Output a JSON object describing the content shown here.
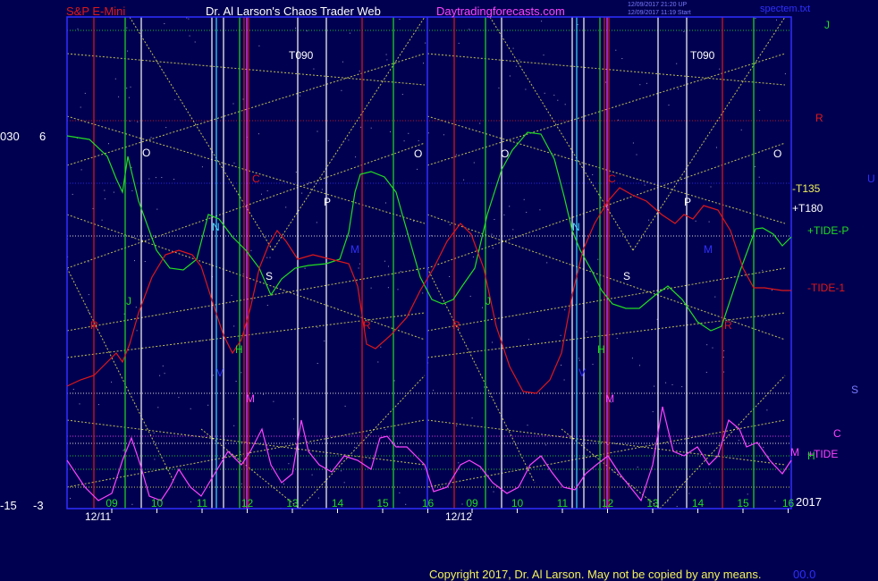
{
  "header": {
    "symbol": "S&P E-Mini",
    "author": "Dr. Al Larson's Chaos Trader Web",
    "site": "Daytradingforecasts.com",
    "stamp1": "12/09/2017 21:20 UP",
    "stamp2": "12/09/2017 11:19 Start",
    "file": "spectem.txt"
  },
  "footer": {
    "copyright": "Copyright 2017, Dr. Al Larson. May not be copied by any means.",
    "tail": "00.0"
  },
  "left_scale": {
    "top_a": "030",
    "top_b": "6",
    "bot_a": "-15",
    "bot_b": "-3"
  },
  "year": "2017",
  "colors": {
    "bg": "#000050",
    "frame": "#2f2fff",
    "green": "#22dd22",
    "red": "#e01818",
    "magenta": "#ff44ff",
    "white": "#ffffff",
    "cyan": "#44ddff",
    "yellow": "#f2f25a",
    "label": "#7a7aff"
  },
  "chart_data": {
    "type": "line",
    "title": "S&P E-Mini",
    "days": [
      "12/11",
      "12/12"
    ],
    "hour_labels": [
      "09",
      "10",
      "11",
      "12",
      "13",
      "14",
      "15",
      "16",
      "09",
      "10",
      "11",
      "12",
      "13",
      "14",
      "15",
      "16"
    ],
    "ylim_left": [
      -3,
      6
    ],
    "series": [
      {
        "name": "+TIDE",
        "color": "#22dd22",
        "points": [
          [
            0,
            152
          ],
          [
            25,
            156
          ],
          [
            45,
            175
          ],
          [
            55,
            200
          ],
          [
            62,
            215
          ],
          [
            68,
            175
          ],
          [
            80,
            225
          ],
          [
            100,
            280
          ],
          [
            115,
            300
          ],
          [
            130,
            302
          ],
          [
            145,
            290
          ],
          [
            158,
            240
          ],
          [
            170,
            245
          ],
          [
            185,
            265
          ],
          [
            200,
            280
          ],
          [
            215,
            300
          ],
          [
            228,
            330
          ],
          [
            240,
            312
          ],
          [
            255,
            300
          ],
          [
            270,
            297
          ],
          [
            290,
            295
          ],
          [
            305,
            290
          ],
          [
            315,
            260
          ],
          [
            322,
            215
          ],
          [
            328,
            195
          ],
          [
            340,
            192
          ],
          [
            355,
            198
          ],
          [
            368,
            215
          ],
          [
            375,
            240
          ],
          [
            385,
            275
          ],
          [
            395,
            310
          ],
          [
            408,
            335
          ],
          [
            420,
            340
          ],
          [
            432,
            335
          ],
          [
            442,
            320
          ],
          [
            456,
            300
          ],
          [
            470,
            240
          ],
          [
            486,
            190
          ],
          [
            498,
            168
          ],
          [
            515,
            148
          ],
          [
            530,
            150
          ],
          [
            545,
            178
          ],
          [
            556,
            220
          ],
          [
            565,
            258
          ],
          [
            574,
            280
          ],
          [
            588,
            305
          ],
          [
            598,
            325
          ],
          [
            610,
            340
          ],
          [
            625,
            345
          ],
          [
            640,
            345
          ],
          [
            658,
            330
          ],
          [
            672,
            320
          ],
          [
            688,
            335
          ],
          [
            705,
            360
          ],
          [
            720,
            370
          ],
          [
            732,
            365
          ],
          [
            742,
            335
          ],
          [
            752,
            305
          ],
          [
            762,
            278
          ],
          [
            770,
            256
          ],
          [
            778,
            255
          ],
          [
            790,
            262
          ],
          [
            800,
            275
          ],
          [
            810,
            265
          ]
        ]
      },
      {
        "name": "-TIDE-1",
        "color": "#e01818",
        "points": [
          [
            0,
            432
          ],
          [
            15,
            425
          ],
          [
            30,
            420
          ],
          [
            45,
            405
          ],
          [
            55,
            395
          ],
          [
            62,
            405
          ],
          [
            70,
            385
          ],
          [
            80,
            350
          ],
          [
            95,
            310
          ],
          [
            110,
            285
          ],
          [
            125,
            280
          ],
          [
            140,
            285
          ],
          [
            150,
            298
          ],
          [
            165,
            345
          ],
          [
            175,
            375
          ],
          [
            185,
            395
          ],
          [
            195,
            380
          ],
          [
            205,
            345
          ],
          [
            215,
            300
          ],
          [
            225,
            275
          ],
          [
            235,
            258
          ],
          [
            245,
            270
          ],
          [
            258,
            290
          ],
          [
            275,
            285
          ],
          [
            295,
            290
          ],
          [
            315,
            295
          ],
          [
            325,
            320
          ],
          [
            335,
            385
          ],
          [
            345,
            390
          ],
          [
            362,
            375
          ],
          [
            380,
            355
          ],
          [
            395,
            325
          ],
          [
            410,
            300
          ],
          [
            425,
            270
          ],
          [
            440,
            250
          ],
          [
            452,
            262
          ],
          [
            466,
            300
          ],
          [
            480,
            365
          ],
          [
            495,
            410
          ],
          [
            510,
            438
          ],
          [
            525,
            440
          ],
          [
            540,
            425
          ],
          [
            553,
            395
          ],
          [
            565,
            330
          ],
          [
            577,
            280
          ],
          [
            590,
            250
          ],
          [
            605,
            225
          ],
          [
            618,
            210
          ],
          [
            632,
            218
          ],
          [
            648,
            225
          ],
          [
            665,
            240
          ],
          [
            680,
            250
          ],
          [
            690,
            240
          ],
          [
            700,
            245
          ],
          [
            712,
            230
          ],
          [
            728,
            235
          ],
          [
            742,
            258
          ],
          [
            756,
            300
          ],
          [
            768,
            322
          ],
          [
            780,
            322
          ],
          [
            800,
            325
          ],
          [
            810,
            325
          ]
        ]
      },
      {
        "name": "+TIDE-P",
        "color": "#ff44ff",
        "points": [
          [
            0,
            515
          ],
          [
            20,
            545
          ],
          [
            35,
            560
          ],
          [
            50,
            552
          ],
          [
            62,
            515
          ],
          [
            72,
            490
          ],
          [
            82,
            520
          ],
          [
            92,
            555
          ],
          [
            105,
            560
          ],
          [
            115,
            545
          ],
          [
            125,
            525
          ],
          [
            138,
            545
          ],
          [
            150,
            555
          ],
          [
            165,
            530
          ],
          [
            180,
            505
          ],
          [
            195,
            520
          ],
          [
            205,
            505
          ],
          [
            218,
            480
          ],
          [
            228,
            520
          ],
          [
            240,
            540
          ],
          [
            252,
            530
          ],
          [
            262,
            470
          ],
          [
            270,
            505
          ],
          [
            282,
            520
          ],
          [
            296,
            528
          ],
          [
            310,
            510
          ],
          [
            325,
            515
          ],
          [
            340,
            525
          ],
          [
            350,
            490
          ],
          [
            358,
            488
          ],
          [
            368,
            500
          ],
          [
            380,
            500
          ],
          [
            390,
            510
          ],
          [
            400,
            520
          ],
          [
            410,
            550
          ],
          [
            425,
            545
          ],
          [
            440,
            520
          ],
          [
            450,
            515
          ],
          [
            462,
            522
          ],
          [
            476,
            540
          ],
          [
            492,
            552
          ],
          [
            505,
            545
          ],
          [
            518,
            520
          ],
          [
            530,
            510
          ],
          [
            542,
            528
          ],
          [
            555,
            545
          ],
          [
            568,
            548
          ],
          [
            580,
            530
          ],
          [
            592,
            520
          ],
          [
            605,
            510
          ],
          [
            618,
            530
          ],
          [
            630,
            545
          ],
          [
            642,
            560
          ],
          [
            655,
            520
          ],
          [
            666,
            455
          ],
          [
            678,
            505
          ],
          [
            690,
            510
          ],
          [
            705,
            500
          ],
          [
            718,
            520
          ],
          [
            728,
            510
          ],
          [
            740,
            470
          ],
          [
            752,
            480
          ],
          [
            760,
            500
          ],
          [
            772,
            495
          ],
          [
            786,
            515
          ],
          [
            800,
            530
          ],
          [
            810,
            515
          ]
        ]
      }
    ],
    "labels": [
      {
        "text": "T090",
        "pos": [
          248,
          66
        ],
        "color": "#ffffff"
      },
      {
        "text": "T090",
        "pos": [
          697,
          66
        ],
        "color": "#ffffff"
      },
      {
        "text": "O",
        "pos": [
          84,
          175
        ],
        "color": "#ffffff"
      },
      {
        "text": "O",
        "pos": [
          388,
          176
        ],
        "color": "#ffffff"
      },
      {
        "text": "O",
        "pos": [
          485,
          176
        ],
        "color": "#ffffff"
      },
      {
        "text": "O",
        "pos": [
          790,
          176
        ],
        "color": "#ffffff"
      },
      {
        "text": "C",
        "pos": [
          207,
          204
        ],
        "color": "#e01818"
      },
      {
        "text": "C",
        "pos": [
          605,
          204
        ],
        "color": "#e01818"
      },
      {
        "text": "P",
        "pos": [
          287,
          230
        ],
        "color": "#ffffff"
      },
      {
        "text": "P",
        "pos": [
          690,
          230
        ],
        "color": "#ffffff"
      },
      {
        "text": "N",
        "pos": [
          162,
          258
        ],
        "color": "#44ddff"
      },
      {
        "text": "N",
        "pos": [
          565,
          258
        ],
        "color": "#44ddff"
      },
      {
        "text": "M",
        "pos": [
          317,
          283
        ],
        "color": "#2f2fff"
      },
      {
        "text": "M",
        "pos": [
          712,
          283
        ],
        "color": "#2f2fff"
      },
      {
        "text": "S",
        "pos": [
          222,
          313
        ],
        "color": "#ffffff"
      },
      {
        "text": "S",
        "pos": [
          622,
          313
        ],
        "color": "#ffffff"
      },
      {
        "text": "J",
        "pos": [
          66,
          341
        ],
        "color": "#22dd22"
      },
      {
        "text": "J",
        "pos": [
          468,
          341
        ],
        "color": "#22dd22"
      },
      {
        "text": "R",
        "pos": [
          26,
          368
        ],
        "color": "#e01818"
      },
      {
        "text": "R",
        "pos": [
          331,
          368
        ],
        "color": "#e01818"
      },
      {
        "text": "R",
        "pos": [
          431,
          368
        ],
        "color": "#e01818"
      },
      {
        "text": "R",
        "pos": [
          735,
          368
        ],
        "color": "#e01818"
      },
      {
        "text": "H",
        "pos": [
          188,
          395
        ],
        "color": "#22dd22"
      },
      {
        "text": "H",
        "pos": [
          593,
          395
        ],
        "color": "#22dd22"
      },
      {
        "text": "V",
        "pos": [
          167,
          421
        ],
        "color": "#2f2fff"
      },
      {
        "text": "V",
        "pos": [
          572,
          421
        ],
        "color": "#2f2fff"
      },
      {
        "text": "M",
        "pos": [
          200,
          450
        ],
        "color": "#ff44ff"
      },
      {
        "text": "M",
        "pos": [
          602,
          450
        ],
        "color": "#ff44ff"
      }
    ],
    "right_labels": [
      {
        "text": "J",
        "color": "#22dd22"
      },
      {
        "text": "R",
        "color": "#e01818"
      },
      {
        "text": "U",
        "color": "#2f2fff"
      },
      {
        "text": "-T135",
        "color": "#f2f25a"
      },
      {
        "text": "+T180",
        "color": "#ffffff"
      },
      {
        "text": "+TIDE-P",
        "color": "#22dd22"
      },
      {
        "text": "-TIDE-1",
        "color": "#e01818"
      },
      {
        "text": "S",
        "color": "#7a7aff"
      },
      {
        "text": "C",
        "color": "#ff44ff"
      },
      {
        "text": "M",
        "color": "#ff44ff"
      },
      {
        "text": "+TIDE",
        "color": "#ff44ff"
      },
      {
        "text": "H",
        "color": "#22dd22"
      }
    ]
  }
}
